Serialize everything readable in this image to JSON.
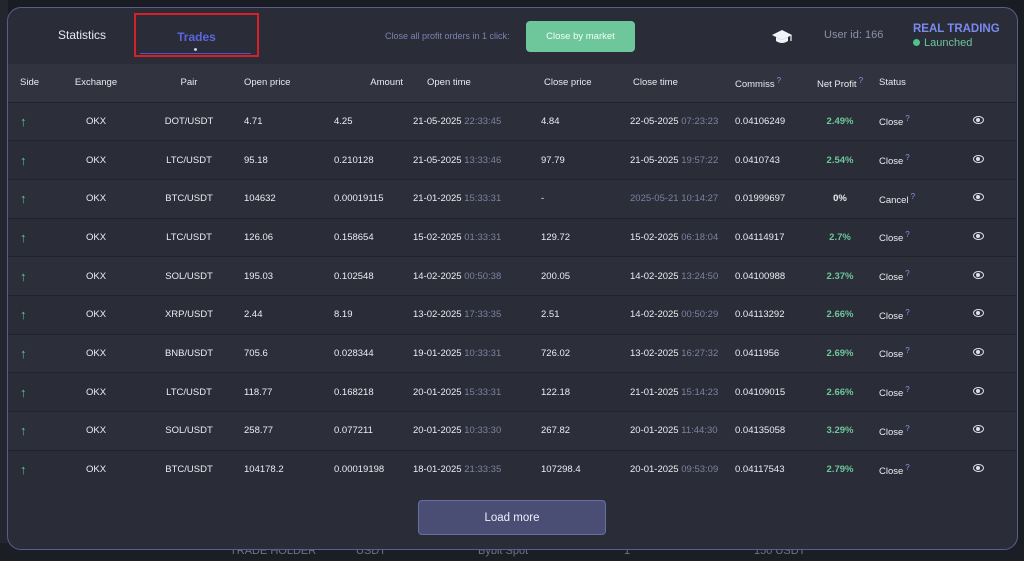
{
  "tabs": {
    "statistics": "Statistics",
    "trades": "Trades"
  },
  "close_hint": "Close all profit orders in 1 click:",
  "close_button": "Close by market",
  "user_id": "User id: 166",
  "mode": {
    "title": "REAL TRADING",
    "state": "Launched"
  },
  "columns": [
    "Side",
    "Exchange",
    "Pair",
    "Open price",
    "Amount",
    "Open time",
    "Close price",
    "Close time",
    "Commiss",
    "Net Profit",
    "Status",
    ""
  ],
  "help_mark": "?",
  "rows": [
    {
      "exchange": "OKX",
      "pair": "DOT/USDT",
      "open_price": "4.71",
      "amount": "4.25",
      "open_date": "21-05-2025",
      "open_clock": "22:33:45",
      "close_price": "4.84",
      "close_date": "22-05-2025",
      "close_clock": "07:23:23",
      "commission": "0.04106249",
      "profit": "2.49%",
      "status": "Close"
    },
    {
      "exchange": "OKX",
      "pair": "LTC/USDT",
      "open_price": "95.18",
      "amount": "0.210128",
      "open_date": "21-05-2025",
      "open_clock": "13:33:46",
      "close_price": "97.79",
      "close_date": "21-05-2025",
      "close_clock": "19:57:22",
      "commission": "0.0410743",
      "profit": "2.54%",
      "status": "Close"
    },
    {
      "exchange": "OKX",
      "pair": "BTC/USDT",
      "open_price": "104632",
      "amount": "0.00019115",
      "open_date": "21-01-2025",
      "open_clock": "15:33:31",
      "close_price": "-",
      "close_date": "2025-05-21 10:14:27",
      "close_clock": "",
      "commission": "0.01999697",
      "profit": "0%",
      "status": "Cancel"
    },
    {
      "exchange": "OKX",
      "pair": "LTC/USDT",
      "open_price": "126.06",
      "amount": "0.158654",
      "open_date": "15-02-2025",
      "open_clock": "01:33:31",
      "close_price": "129.72",
      "close_date": "15-02-2025",
      "close_clock": "06:18:04",
      "commission": "0.04114917",
      "profit": "2.7%",
      "status": "Close"
    },
    {
      "exchange": "OKX",
      "pair": "SOL/USDT",
      "open_price": "195.03",
      "amount": "0.102548",
      "open_date": "14-02-2025",
      "open_clock": "00:50:38",
      "close_price": "200.05",
      "close_date": "14-02-2025",
      "close_clock": "13:24:50",
      "commission": "0.04100988",
      "profit": "2.37%",
      "status": "Close"
    },
    {
      "exchange": "OKX",
      "pair": "XRP/USDT",
      "open_price": "2.44",
      "amount": "8.19",
      "open_date": "13-02-2025",
      "open_clock": "17:33:35",
      "close_price": "2.51",
      "close_date": "14-02-2025",
      "close_clock": "00:50:29",
      "commission": "0.04113292",
      "profit": "2.66%",
      "status": "Close"
    },
    {
      "exchange": "OKX",
      "pair": "BNB/USDT",
      "open_price": "705.6",
      "amount": "0.028344",
      "open_date": "19-01-2025",
      "open_clock": "10:33:31",
      "close_price": "726.02",
      "close_date": "13-02-2025",
      "close_clock": "16:27:32",
      "commission": "0.0411956",
      "profit": "2.69%",
      "status": "Close"
    },
    {
      "exchange": "OKX",
      "pair": "LTC/USDT",
      "open_price": "118.77",
      "amount": "0.168218",
      "open_date": "20-01-2025",
      "open_clock": "15:33:31",
      "close_price": "122.18",
      "close_date": "21-01-2025",
      "close_clock": "15:14:23",
      "commission": "0.04109015",
      "profit": "2.66%",
      "status": "Close"
    },
    {
      "exchange": "OKX",
      "pair": "SOL/USDT",
      "open_price": "258.77",
      "amount": "0.077211",
      "open_date": "20-01-2025",
      "open_clock": "10:33:30",
      "close_price": "267.82",
      "close_date": "20-01-2025",
      "close_clock": "11:44:30",
      "commission": "0.04135058",
      "profit": "3.29%",
      "status": "Close"
    },
    {
      "exchange": "OKX",
      "pair": "BTC/USDT",
      "open_price": "104178.2",
      "amount": "0.00019198",
      "open_date": "18-01-2025",
      "open_clock": "21:33:35",
      "close_price": "107298.4",
      "close_date": "20-01-2025",
      "close_clock": "09:53:09",
      "commission": "0.04117543",
      "profit": "2.79%",
      "status": "Close"
    }
  ],
  "load_more": "Load more",
  "background_fragments": [
    "TRADE HOLDER",
    "USDT",
    "Bybit Spot",
    "1",
    "150 USDT"
  ],
  "colors": {
    "accent": "#5b66e0",
    "profit": "#6dc79a",
    "highlight": "#d8202a",
    "button": "#6dc79a"
  }
}
